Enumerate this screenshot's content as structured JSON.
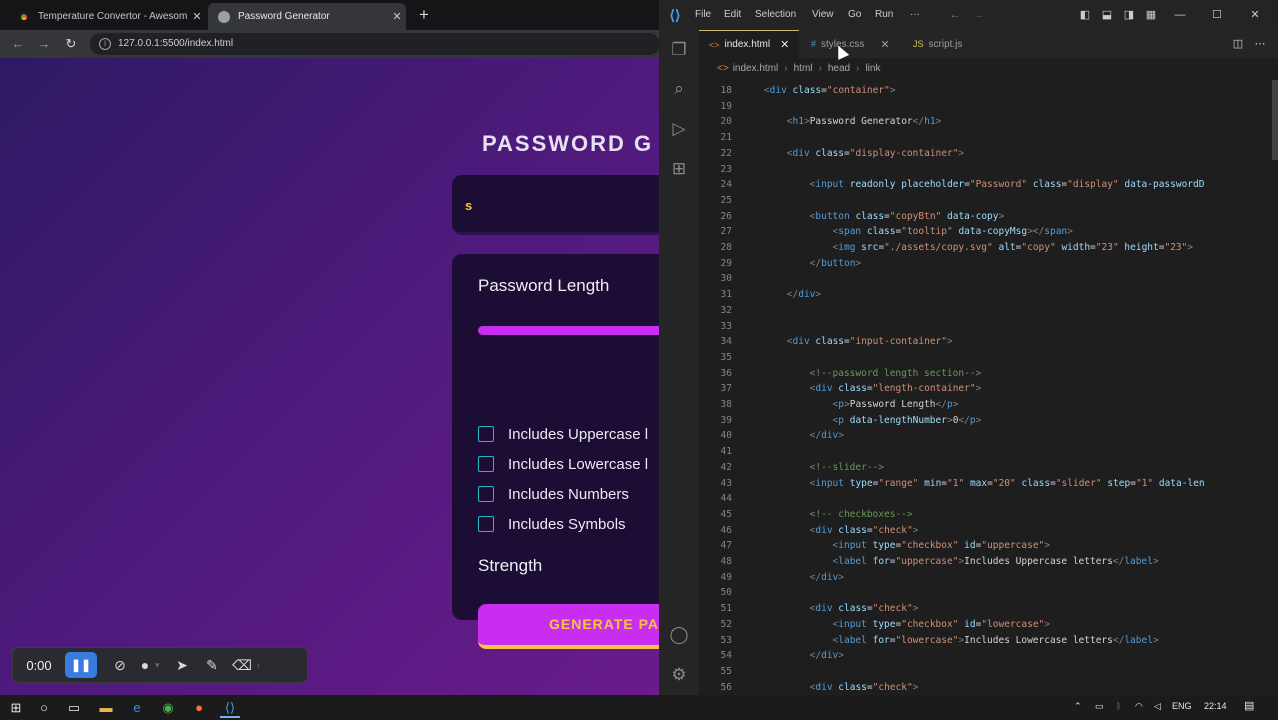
{
  "browser": {
    "tabs": [
      {
        "title": "Temperature Convertor - Awesom",
        "favicon_color": "#e94b3c"
      },
      {
        "title": "Password Generator",
        "favicon_color": "#9aa0a6"
      }
    ],
    "url": "127.0.0.1:5500/index.html",
    "page": {
      "heading": "PASSWORD G",
      "display_value": "s",
      "length_label": "Password Length",
      "slider_fill_fraction": 1.0,
      "checkboxes": [
        {
          "label": "Includes Uppercase l",
          "checked": false
        },
        {
          "label": "Includes Lowercase l",
          "checked": false
        },
        {
          "label": "Includes Numbers",
          "checked": false
        },
        {
          "label": "Includes Symbols",
          "checked": false
        }
      ],
      "strength_label": "Strength",
      "generate_label": "GENERATE PA"
    }
  },
  "recorder": {
    "time": "0:00",
    "icons": [
      "pause-icon",
      "camera-off-icon",
      "microphone-icon",
      "pointer-icon",
      "pen-icon",
      "eraser-icon"
    ]
  },
  "vscode": {
    "menu": [
      "File",
      "Edit",
      "Selection",
      "View",
      "Go",
      "Run",
      "···"
    ],
    "tabs": [
      {
        "name": "index.html",
        "active": true,
        "icon": "<>"
      },
      {
        "name": "styles.css",
        "active": false,
        "icon": "#"
      },
      {
        "name": "script.js",
        "active": false,
        "icon": "JS"
      }
    ],
    "breadcrumbs": [
      "index.html",
      "html",
      "head",
      "link"
    ],
    "lines": [
      {
        "n": "18",
        "indent": 4,
        "tokens": [
          [
            "pun",
            "<"
          ],
          [
            "tag",
            "div"
          ],
          [
            "txt",
            " "
          ],
          [
            "attr",
            "class"
          ],
          [
            "txt",
            "="
          ],
          [
            "str",
            "\"container\""
          ],
          [
            "pun",
            ">"
          ]
        ]
      },
      {
        "n": "19",
        "indent": 0,
        "tokens": []
      },
      {
        "n": "20",
        "indent": 8,
        "tokens": [
          [
            "pun",
            "<"
          ],
          [
            "tag",
            "h1"
          ],
          [
            "pun",
            ">"
          ],
          [
            "txt",
            "Password Generator"
          ],
          [
            "pun",
            "</"
          ],
          [
            "tag",
            "h1"
          ],
          [
            "pun",
            ">"
          ]
        ]
      },
      {
        "n": "21",
        "indent": 0,
        "tokens": []
      },
      {
        "n": "22",
        "indent": 8,
        "tokens": [
          [
            "pun",
            "<"
          ],
          [
            "tag",
            "div"
          ],
          [
            "txt",
            " "
          ],
          [
            "attr",
            "class"
          ],
          [
            "txt",
            "="
          ],
          [
            "str",
            "\"display-container\""
          ],
          [
            "pun",
            ">"
          ]
        ]
      },
      {
        "n": "23",
        "indent": 0,
        "tokens": []
      },
      {
        "n": "24",
        "indent": 12,
        "tokens": [
          [
            "pun",
            "<"
          ],
          [
            "tag",
            "input"
          ],
          [
            "txt",
            " "
          ],
          [
            "attr",
            "readonly"
          ],
          [
            "txt",
            " "
          ],
          [
            "attr",
            "placeholder"
          ],
          [
            "txt",
            "="
          ],
          [
            "str",
            "\"Password\""
          ],
          [
            "txt",
            " "
          ],
          [
            "attr",
            "class"
          ],
          [
            "txt",
            "="
          ],
          [
            "str",
            "\"display\""
          ],
          [
            "txt",
            " "
          ],
          [
            "attr",
            "data-passwordD"
          ]
        ]
      },
      {
        "n": "25",
        "indent": 0,
        "tokens": []
      },
      {
        "n": "26",
        "indent": 12,
        "tokens": [
          [
            "pun",
            "<"
          ],
          [
            "tag",
            "button"
          ],
          [
            "txt",
            " "
          ],
          [
            "attr",
            "class"
          ],
          [
            "txt",
            "="
          ],
          [
            "str",
            "\"copyBtn\""
          ],
          [
            "txt",
            " "
          ],
          [
            "attr",
            "data-copy"
          ],
          [
            "pun",
            ">"
          ]
        ]
      },
      {
        "n": "27",
        "indent": 16,
        "tokens": [
          [
            "pun",
            "<"
          ],
          [
            "tag",
            "span"
          ],
          [
            "txt",
            " "
          ],
          [
            "attr",
            "class"
          ],
          [
            "txt",
            "="
          ],
          [
            "str",
            "\"tooltip\""
          ],
          [
            "txt",
            " "
          ],
          [
            "attr",
            "data-copyMsg"
          ],
          [
            "pun",
            "></"
          ],
          [
            "tag",
            "span"
          ],
          [
            "pun",
            ">"
          ]
        ]
      },
      {
        "n": "28",
        "indent": 16,
        "tokens": [
          [
            "pun",
            "<"
          ],
          [
            "tag",
            "img"
          ],
          [
            "txt",
            " "
          ],
          [
            "attr",
            "src"
          ],
          [
            "txt",
            "="
          ],
          [
            "str",
            "\"./assets/copy.svg\""
          ],
          [
            "txt",
            " "
          ],
          [
            "attr",
            "alt"
          ],
          [
            "txt",
            "="
          ],
          [
            "str",
            "\"copy\""
          ],
          [
            "txt",
            " "
          ],
          [
            "attr",
            "width"
          ],
          [
            "txt",
            "="
          ],
          [
            "str",
            "\"23\""
          ],
          [
            "txt",
            " "
          ],
          [
            "attr",
            "height"
          ],
          [
            "txt",
            "="
          ],
          [
            "str",
            "\"23\""
          ],
          [
            "pun",
            ">"
          ]
        ]
      },
      {
        "n": "29",
        "indent": 12,
        "tokens": [
          [
            "pun",
            "</"
          ],
          [
            "tag",
            "button"
          ],
          [
            "pun",
            ">"
          ]
        ]
      },
      {
        "n": "30",
        "indent": 0,
        "tokens": []
      },
      {
        "n": "31",
        "indent": 8,
        "tokens": [
          [
            "pun",
            "</"
          ],
          [
            "tag",
            "div"
          ],
          [
            "pun",
            ">"
          ]
        ]
      },
      {
        "n": "32",
        "indent": 0,
        "tokens": []
      },
      {
        "n": "33",
        "indent": 0,
        "tokens": []
      },
      {
        "n": "34",
        "indent": 8,
        "tokens": [
          [
            "pun",
            "<"
          ],
          [
            "tag",
            "div"
          ],
          [
            "txt",
            " "
          ],
          [
            "attr",
            "class"
          ],
          [
            "txt",
            "="
          ],
          [
            "str",
            "\"input-container\""
          ],
          [
            "pun",
            ">"
          ]
        ]
      },
      {
        "n": "35",
        "indent": 0,
        "tokens": []
      },
      {
        "n": "36",
        "indent": 12,
        "tokens": [
          [
            "com",
            "<!--password length section-->"
          ]
        ]
      },
      {
        "n": "37",
        "indent": 12,
        "tokens": [
          [
            "pun",
            "<"
          ],
          [
            "tag",
            "div"
          ],
          [
            "txt",
            " "
          ],
          [
            "attr",
            "class"
          ],
          [
            "txt",
            "="
          ],
          [
            "str",
            "\"length-container\""
          ],
          [
            "pun",
            ">"
          ]
        ]
      },
      {
        "n": "38",
        "indent": 16,
        "tokens": [
          [
            "pun",
            "<"
          ],
          [
            "tag",
            "p"
          ],
          [
            "pun",
            ">"
          ],
          [
            "txt",
            "Password Length"
          ],
          [
            "pun",
            "</"
          ],
          [
            "tag",
            "p"
          ],
          [
            "pun",
            ">"
          ]
        ]
      },
      {
        "n": "39",
        "indent": 16,
        "tokens": [
          [
            "pun",
            "<"
          ],
          [
            "tag",
            "p"
          ],
          [
            "txt",
            " "
          ],
          [
            "attr",
            "data-lengthNumber"
          ],
          [
            "pun",
            ">"
          ],
          [
            "txt",
            "0"
          ],
          [
            "pun",
            "</"
          ],
          [
            "tag",
            "p"
          ],
          [
            "pun",
            ">"
          ]
        ]
      },
      {
        "n": "40",
        "indent": 12,
        "tokens": [
          [
            "pun",
            "</"
          ],
          [
            "tag",
            "div"
          ],
          [
            "pun",
            ">"
          ]
        ]
      },
      {
        "n": "41",
        "indent": 0,
        "tokens": []
      },
      {
        "n": "42",
        "indent": 12,
        "tokens": [
          [
            "com",
            "<!--slider-->"
          ]
        ]
      },
      {
        "n": "43",
        "indent": 12,
        "tokens": [
          [
            "pun",
            "<"
          ],
          [
            "tag",
            "input"
          ],
          [
            "txt",
            " "
          ],
          [
            "attr",
            "type"
          ],
          [
            "txt",
            "="
          ],
          [
            "str",
            "\"range\""
          ],
          [
            "txt",
            " "
          ],
          [
            "attr",
            "min"
          ],
          [
            "txt",
            "="
          ],
          [
            "str",
            "\"1\""
          ],
          [
            "txt",
            " "
          ],
          [
            "attr",
            "max"
          ],
          [
            "txt",
            "="
          ],
          [
            "str",
            "\"20\""
          ],
          [
            "txt",
            " "
          ],
          [
            "attr",
            "class"
          ],
          [
            "txt",
            "="
          ],
          [
            "str",
            "\"slider\""
          ],
          [
            "txt",
            " "
          ],
          [
            "attr",
            "step"
          ],
          [
            "txt",
            "="
          ],
          [
            "str",
            "\"1\""
          ],
          [
            "txt",
            " "
          ],
          [
            "attr",
            "data-len"
          ]
        ]
      },
      {
        "n": "44",
        "indent": 0,
        "tokens": []
      },
      {
        "n": "45",
        "indent": 12,
        "tokens": [
          [
            "com",
            "<!-- checkboxes-->"
          ]
        ]
      },
      {
        "n": "46",
        "indent": 12,
        "tokens": [
          [
            "pun",
            "<"
          ],
          [
            "tag",
            "div"
          ],
          [
            "txt",
            " "
          ],
          [
            "attr",
            "class"
          ],
          [
            "txt",
            "="
          ],
          [
            "str",
            "\"check\""
          ],
          [
            "pun",
            ">"
          ]
        ]
      },
      {
        "n": "47",
        "indent": 16,
        "tokens": [
          [
            "pun",
            "<"
          ],
          [
            "tag",
            "input"
          ],
          [
            "txt",
            " "
          ],
          [
            "attr",
            "type"
          ],
          [
            "txt",
            "="
          ],
          [
            "str",
            "\"checkbox\""
          ],
          [
            "txt",
            " "
          ],
          [
            "attr",
            "id"
          ],
          [
            "txt",
            "="
          ],
          [
            "str",
            "\"uppercase\""
          ],
          [
            "pun",
            ">"
          ]
        ]
      },
      {
        "n": "48",
        "indent": 16,
        "tokens": [
          [
            "pun",
            "<"
          ],
          [
            "tag",
            "label"
          ],
          [
            "txt",
            " "
          ],
          [
            "attr",
            "for"
          ],
          [
            "txt",
            "="
          ],
          [
            "str",
            "\"uppercase\""
          ],
          [
            "pun",
            ">"
          ],
          [
            "txt",
            "Includes Uppercase letters"
          ],
          [
            "pun",
            "</"
          ],
          [
            "tag",
            "label"
          ],
          [
            "pun",
            ">"
          ]
        ]
      },
      {
        "n": "49",
        "indent": 12,
        "tokens": [
          [
            "pun",
            "</"
          ],
          [
            "tag",
            "div"
          ],
          [
            "pun",
            ">"
          ]
        ]
      },
      {
        "n": "50",
        "indent": 0,
        "tokens": []
      },
      {
        "n": "51",
        "indent": 12,
        "tokens": [
          [
            "pun",
            "<"
          ],
          [
            "tag",
            "div"
          ],
          [
            "txt",
            " "
          ],
          [
            "attr",
            "class"
          ],
          [
            "txt",
            "="
          ],
          [
            "str",
            "\"check\""
          ],
          [
            "pun",
            ">"
          ]
        ]
      },
      {
        "n": "52",
        "indent": 16,
        "tokens": [
          [
            "pun",
            "<"
          ],
          [
            "tag",
            "input"
          ],
          [
            "txt",
            " "
          ],
          [
            "attr",
            "type"
          ],
          [
            "txt",
            "="
          ],
          [
            "str",
            "\"checkbox\""
          ],
          [
            "txt",
            " "
          ],
          [
            "attr",
            "id"
          ],
          [
            "txt",
            "="
          ],
          [
            "str",
            "\"lowercase\""
          ],
          [
            "pun",
            ">"
          ]
        ]
      },
      {
        "n": "53",
        "indent": 16,
        "tokens": [
          [
            "pun",
            "<"
          ],
          [
            "tag",
            "label"
          ],
          [
            "txt",
            " "
          ],
          [
            "attr",
            "for"
          ],
          [
            "txt",
            "="
          ],
          [
            "str",
            "\"lowercase\""
          ],
          [
            "pun",
            ">"
          ],
          [
            "txt",
            "Includes Lowercase letters"
          ],
          [
            "pun",
            "</"
          ],
          [
            "tag",
            "label"
          ],
          [
            "pun",
            ">"
          ]
        ]
      },
      {
        "n": "54",
        "indent": 12,
        "tokens": [
          [
            "pun",
            "</"
          ],
          [
            "tag",
            "div"
          ],
          [
            "pun",
            ">"
          ]
        ]
      },
      {
        "n": "55",
        "indent": 0,
        "tokens": []
      },
      {
        "n": "56",
        "indent": 12,
        "tokens": [
          [
            "pun",
            "<"
          ],
          [
            "tag",
            "div"
          ],
          [
            "txt",
            " "
          ],
          [
            "attr",
            "class"
          ],
          [
            "txt",
            "="
          ],
          [
            "str",
            "\"check\""
          ],
          [
            "pun",
            ">"
          ]
        ]
      }
    ]
  },
  "taskbar": {
    "language": "ENG",
    "time": "22:14"
  }
}
